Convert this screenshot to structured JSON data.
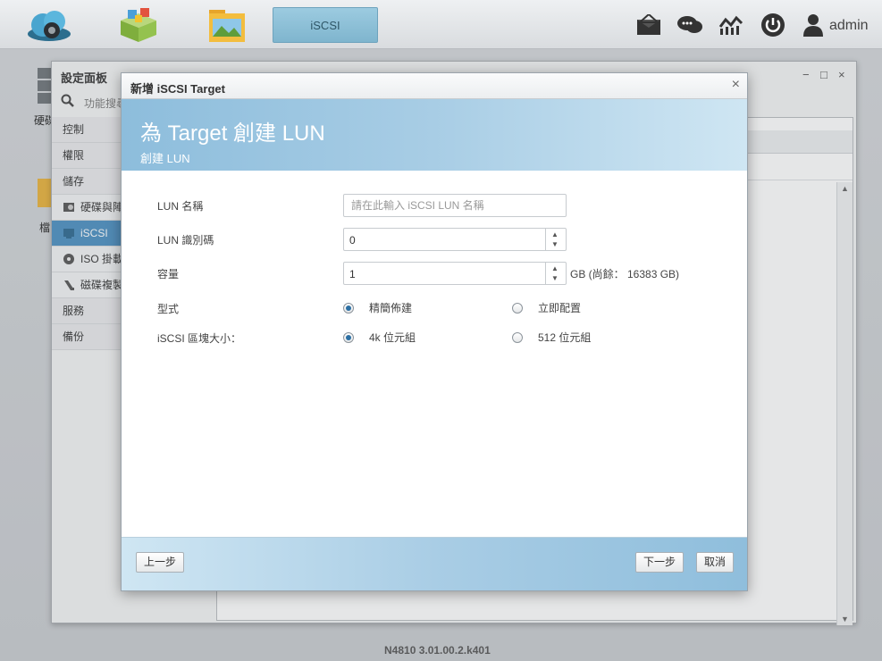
{
  "taskbar": {
    "active_app_label": "iSCSI",
    "user_label": "admin",
    "icons": [
      "cloud-app-icon",
      "app-store-icon",
      "file-manager-icon",
      "mail-icon",
      "chat-icon",
      "monitor-icon",
      "power-icon",
      "user-icon"
    ]
  },
  "desktop": {
    "icon1_label": "硬碟",
    "icon2_label": "檔"
  },
  "control_panel": {
    "title": "設定面板",
    "search_placeholder": "功能搜尋",
    "nav": [
      {
        "label": "控制"
      },
      {
        "label": "權限"
      },
      {
        "label": "儲存"
      },
      {
        "label": "硬碟與陣列"
      },
      {
        "label": "iSCSI"
      },
      {
        "label": "ISO 掛載"
      },
      {
        "label": "磁碟複製"
      },
      {
        "label": "服務"
      },
      {
        "label": "備份"
      }
    ],
    "window_controls": [
      "−",
      "□",
      "×"
    ],
    "version": "N4810   3.01.00.2.k401"
  },
  "modal": {
    "title": "新增 iSCSI Target",
    "close": "×",
    "banner_title": "為 Target 創建 LUN",
    "banner_subtitle": "創建 LUN",
    "fields": {
      "lun_name": {
        "label": "LUN 名稱",
        "value": "",
        "placeholder": "請在此輸入 iSCSI LUN 名稱"
      },
      "lun_id": {
        "label": "LUN 識別碼",
        "value": "0"
      },
      "capacity": {
        "label": "容量",
        "value": "1",
        "unit": "GB (尚餘： 16383 GB)"
      },
      "type": {
        "label": "型式",
        "option1": "精簡佈建",
        "option2": "立即配置",
        "selected": "精簡佈建"
      },
      "block_size": {
        "label": "iSCSI 區塊大小：",
        "option1": "4k 位元組",
        "option2": "512 位元組",
        "selected": "4k 位元組"
      }
    },
    "buttons": {
      "prev": "上一步",
      "next": "下一步",
      "cancel": "取消"
    }
  },
  "colors": {
    "accent": "#4b8fc1",
    "banner": "#8dbddc",
    "radio_selected": "#2c6fa3"
  }
}
